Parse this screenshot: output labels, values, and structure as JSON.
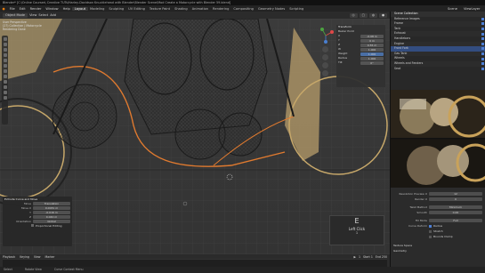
{
  "title": "Blender* [C:\\Online Courses\\ Creative TUTs\\Harley-Davidson Knucklehead with Blender\\Blender Scene\\Mod Create a Motorcycle with Blender 59.blend]",
  "menu": [
    "File",
    "Edit",
    "Render",
    "Window",
    "Help"
  ],
  "workspaces": [
    "Layout",
    "Modeling",
    "Sculpting",
    "UV Editing",
    "Texture Paint",
    "Shading",
    "Animation",
    "Rendering",
    "Compositing",
    "Geometry Nodes",
    "Scripting"
  ],
  "active_workspace": "Layout",
  "scene": "Scene",
  "view_layer": "ViewLayer",
  "header": {
    "mode": "Object Mode",
    "view": "View",
    "select": "Select",
    "add": "Add"
  },
  "viewport": {
    "info_line1": "User Perspective",
    "info_line2": "(27) Collection | Motorcycle",
    "info_line3": "Rendering Done"
  },
  "npanel": {
    "title": "Transform",
    "subtitle": "Bezier Point",
    "rows": [
      {
        "label": "X",
        "value": "-0.08 m"
      },
      {
        "label": "Y",
        "value": "0 m"
      },
      {
        "label": "Z",
        "value": "0.55 m"
      },
      {
        "label": "W",
        "value": "1.000"
      },
      {
        "label": "Weight",
        "value": "1.000"
      },
      {
        "label": "Radius",
        "value": "1.000"
      },
      {
        "label": "Tilt",
        "value": "0°"
      }
    ]
  },
  "operator": {
    "title": "Extrude Curve and Move",
    "rows": [
      {
        "label": "Move",
        "value": "Translation"
      },
      {
        "label": "Move X",
        "value": "0.0031 m"
      },
      {
        "label": "Y",
        "value": "-0.016 m"
      },
      {
        "label": "Z",
        "value": "0.040 m"
      },
      {
        "label": "Orientation",
        "value": "Global"
      },
      {
        "label": "Proportional Editing",
        "value": ""
      }
    ]
  },
  "keypress": {
    "key": "E",
    "action": "Left Click",
    "num": "1"
  },
  "timeline": {
    "playback": "Playback",
    "keying": "Keying",
    "view": "View",
    "marker": "Marker",
    "frame": "1",
    "start": "Start 1",
    "end": "End 250"
  },
  "status": [
    "Select",
    "Rotate View",
    "Curve Context Menu"
  ],
  "outliner": {
    "title": "Scene Collection",
    "items": [
      {
        "label": "Reference Images",
        "sel": false
      },
      {
        "label": "Frame",
        "sel": false
      },
      {
        "label": "Tank",
        "sel": false
      },
      {
        "label": "Exhaust",
        "sel": false
      },
      {
        "label": "Handlebars",
        "sel": false
      },
      {
        "label": "Engine",
        "sel": false
      },
      {
        "label": "Front Fork",
        "sel": true
      },
      {
        "label": "Gas Tank",
        "sel": false
      },
      {
        "label": "Wheels",
        "sel": false
      },
      {
        "label": "Wheels and Fenders",
        "sel": false
      },
      {
        "label": "Seat",
        "sel": false
      }
    ]
  },
  "properties": {
    "rows": [
      {
        "label": "Resolution Preview U",
        "value": "12"
      },
      {
        "label": "Render U",
        "value": "0"
      },
      {
        "label": "Twist Method",
        "value": "Minimum"
      },
      {
        "label": "Smooth",
        "value": "0.00"
      },
      {
        "label": "Fill Mode",
        "value": "Full"
      }
    ],
    "deform_label": "Curve Deform",
    "radius_label": "Radius",
    "stretch_label": "Stretch",
    "bounds_label": "Bounds Clamp",
    "texture_space": "Texture Space",
    "geometry": "Geometry"
  },
  "colors": {
    "accent": "#4d7fd6",
    "selection": "#334d80",
    "active_workspace": "#3a3a3a"
  }
}
